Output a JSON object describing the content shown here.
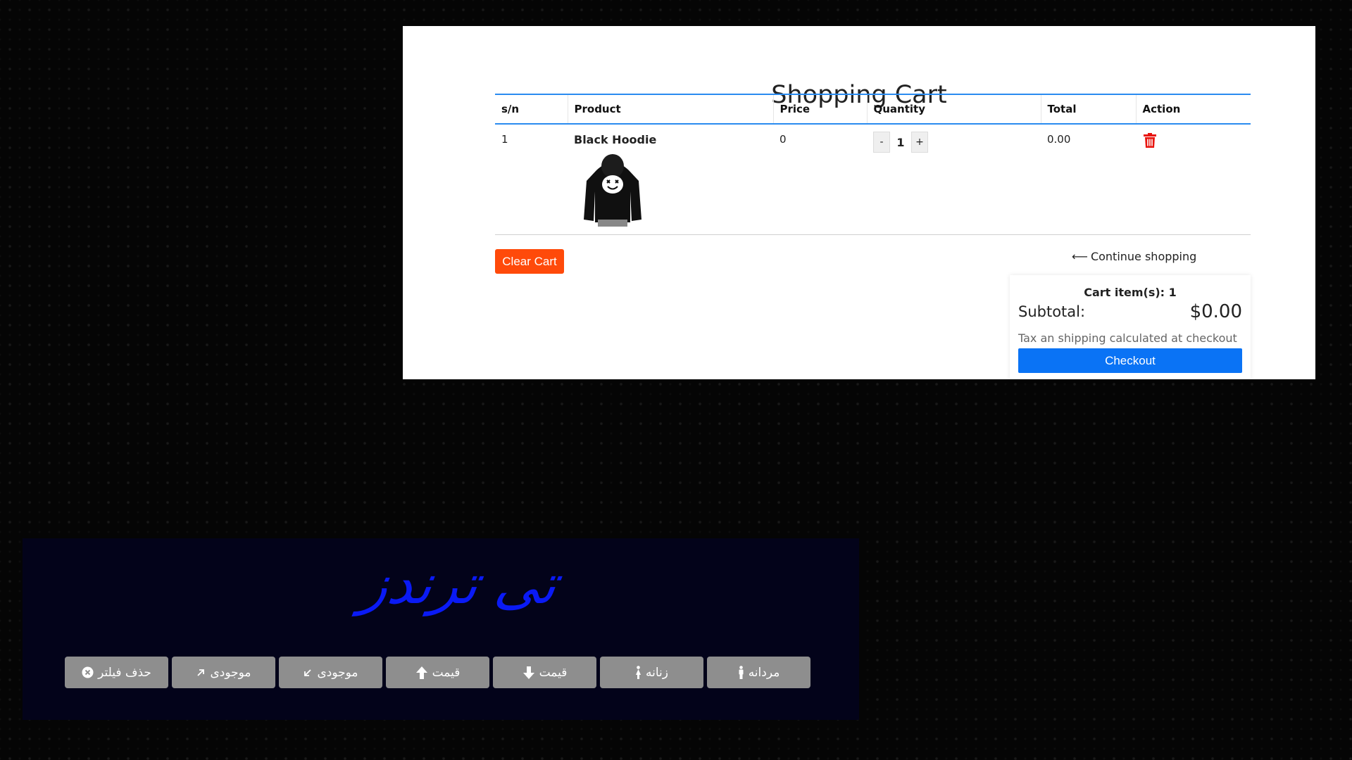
{
  "cart": {
    "title": "Shopping Cart",
    "columns": [
      "s/n",
      "Product",
      "Price",
      "Quantity",
      "Total",
      "Action"
    ],
    "rows": [
      {
        "sn": "1",
        "product": "Black Hoodie",
        "price": "0",
        "quantity": "1",
        "total": "0.00"
      }
    ],
    "qty_minus": "-",
    "qty_plus": "+",
    "clear_label": "Clear Cart",
    "continue_arrow": "⟵",
    "continue_label": "Continue shopping",
    "summary": {
      "count_label": "Cart item(s): 1",
      "subtotal_label": "Subtotal:",
      "subtotal_value": "$0.00",
      "tax_note": "Tax an shipping calculated at checkout",
      "checkout_label": "Checkout"
    },
    "colors": {
      "clear": "#ff4a0a",
      "checkout": "#0a73f5",
      "header_rule": "#2a8bf0",
      "trash": "#e8140e"
    }
  },
  "panel": {
    "logo_text": "تی ترندز",
    "logo_color": "#0a1af5",
    "filters": [
      {
        "label": "حذف فیلتر",
        "icon": "clear-circle-icon"
      },
      {
        "label": "موجودی",
        "icon": "arrow-up-right-icon"
      },
      {
        "label": "موجودی",
        "icon": "arrow-down-left-icon"
      },
      {
        "label": "قیمت",
        "icon": "arrow-up-icon"
      },
      {
        "label": "قیمت",
        "icon": "arrow-down-icon"
      },
      {
        "label": "زنانه",
        "icon": "woman-icon"
      },
      {
        "label": "مردانه",
        "icon": "man-icon"
      }
    ]
  }
}
